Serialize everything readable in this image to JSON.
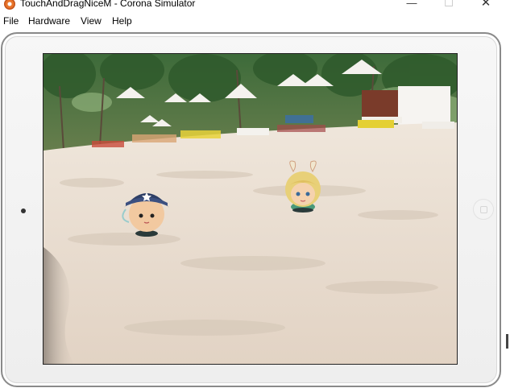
{
  "window": {
    "title": "TouchAndDragNiceM - Corona Simulator",
    "min_glyph": "—",
    "max_glyph": "☐",
    "close_glyph": "✕"
  },
  "menu": {
    "file": "File",
    "hardware": "Hardware",
    "view": "View",
    "help": "Help"
  },
  "scene": {
    "background": "beach-photo",
    "characters": [
      {
        "name": "pirate-kid-sprite"
      },
      {
        "name": "bunny-girl-sprite"
      }
    ]
  },
  "colors": {
    "app_icon": "#e8742a",
    "device_frame": "#8a8a8a",
    "sand": "#e9ddd0"
  }
}
